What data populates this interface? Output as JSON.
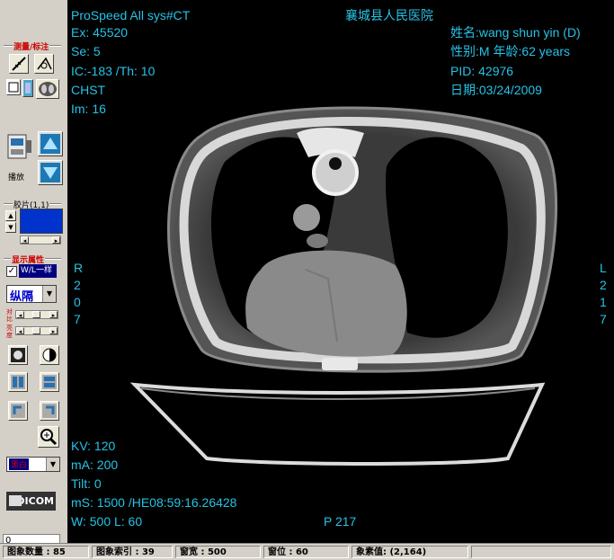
{
  "toolbar": {
    "measure_title": "测量/标注",
    "play_label": "播放",
    "film_title": "胶片(1,1)",
    "display_title": "显示属性",
    "sync_checkbox_label": "W/L一样",
    "sync_checked": "✓",
    "layout_select": "纵隔",
    "contrast_label": "对比",
    "brightness_label": "亮度",
    "color_select": "黑白",
    "dicom_label": "DICOM",
    "frame_input": "0"
  },
  "overlay": {
    "top_left": [
      "ProSpeed All  sys#CT",
      "Ex: 45520",
      "Se: 5",
      "IC:-183 /Th: 10",
      "CHST",
      "Im: 16"
    ],
    "hospital": "襄城县人民医院",
    "top_right": [
      "姓名:wang shun yin (D)",
      "性别:M  年龄:62 years",
      "PID: 42976",
      "日期:03/24/2009"
    ],
    "bottom_left": [
      "KV: 120",
      "mA: 200",
      "Tilt: 0",
      "mS: 1500  /HE08:59:16.26428",
      "W: 500 L: 60"
    ],
    "position": "P 217",
    "left_marker": [
      "R",
      "2",
      "0",
      "7"
    ],
    "right_marker": [
      "L",
      "2",
      "1",
      "7"
    ]
  },
  "status": {
    "image_count": "图象数量 : 85",
    "image_index": "图象索引 : 39",
    "window_width": "窗宽 : 500",
    "window_level": "窗位 : 60",
    "pixel_value": "象素值: (2,164)"
  },
  "colors": {
    "overlay_text": "#26c3e6",
    "toolbar_bg": "#d4d0c8",
    "group_title": "#cc0000",
    "film_box": "#0033cc",
    "arrow_button": "#1e78b4"
  }
}
